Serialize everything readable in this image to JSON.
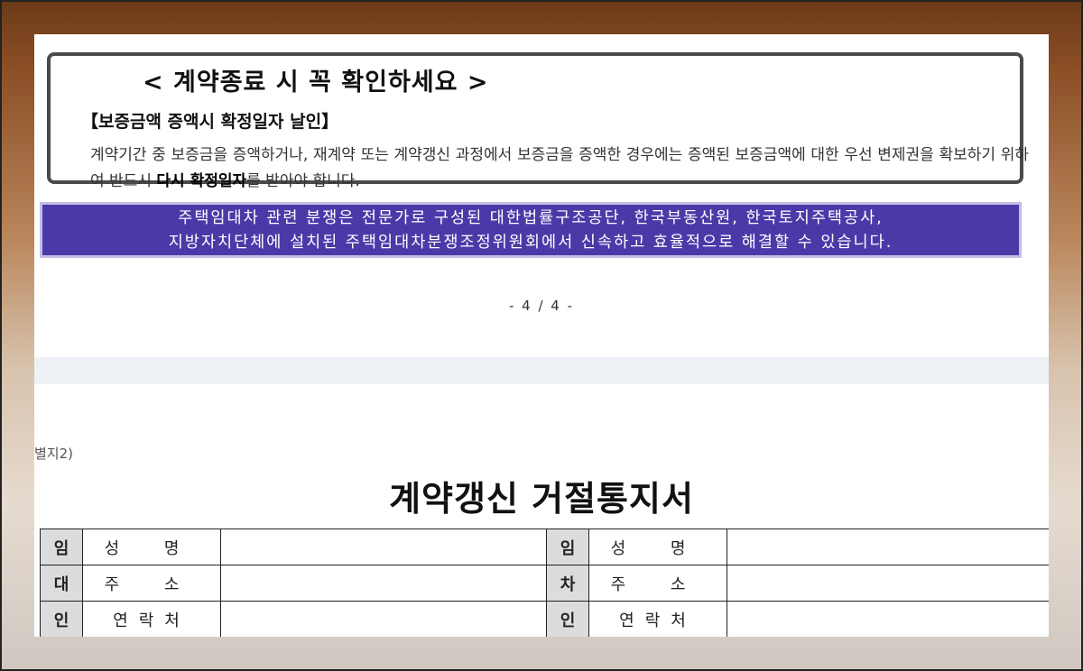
{
  "notice": {
    "title": "< 계약종료 시 꼭 확인하세요 >",
    "subtitle": "【보증금액 증액시 확정일자 날인】",
    "body_part1": "계약기간 중 보증금을 증액하거나, 재계약 또는 계약갱신 과정에서 보증금을 증액한 경우에는 증액된 보증금액에 대한 우선 변제권을 확보하기 위하여 반드시 ",
    "body_bold": "다시 확정일자",
    "body_part2": "를 받아야 합니다."
  },
  "banner": {
    "line1": "주택임대차 관련 분쟁은 전문가로 구성된 대한법률구조공단, 한국부동산원, 한국토지주택공사,",
    "line2": "지방자치단체에 설치된 주택임대차분쟁조정위원회에서 신속하고 효율적으로 해결할 수 있습니다."
  },
  "page_number": "- 4 / 4 -",
  "form": {
    "annex_label": "별지2)",
    "title": "계약갱신 거절통지서",
    "landlord_side": [
      "임",
      "대",
      "인"
    ],
    "tenant_side": [
      "임",
      "차",
      "인"
    ],
    "field_name": "성 명",
    "field_address": "주 소",
    "field_contact": "연락처"
  },
  "colors": {
    "banner_bg": "#4a3aa8",
    "banner_border": "#c4bde6",
    "side_cell_bg": "#dcdcdc"
  }
}
